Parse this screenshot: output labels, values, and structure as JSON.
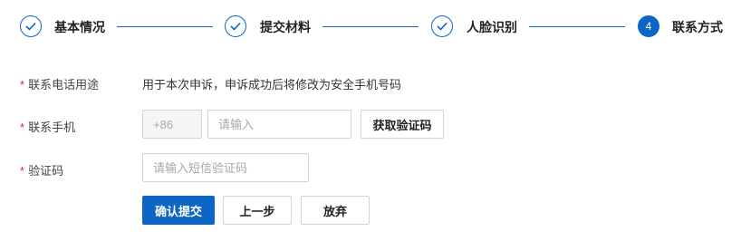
{
  "steps": [
    {
      "label": "基本情况",
      "state": "done",
      "icon": "check-icon"
    },
    {
      "label": "提交材料",
      "state": "done",
      "icon": "check-icon"
    },
    {
      "label": "人脸识别",
      "state": "done",
      "icon": "check-icon"
    },
    {
      "label": "联系方式",
      "state": "active",
      "number": "4"
    }
  ],
  "form": {
    "required_mark": "*",
    "usage": {
      "label": "联系电话用途",
      "text": "用于本次申诉，申诉成功后将修改为安全手机号码"
    },
    "phone": {
      "label": "联系手机",
      "prefix": "+86",
      "placeholder": "请输入",
      "value": "",
      "get_code_label": "获取验证码"
    },
    "code": {
      "label": "验证码",
      "placeholder": "请输入短信验证码",
      "value": ""
    }
  },
  "actions": {
    "confirm_label": "确认提交",
    "prev_label": "上一步",
    "abandon_label": "放弃"
  },
  "colors": {
    "accent": "#0d66c6",
    "required": "#e02020"
  }
}
